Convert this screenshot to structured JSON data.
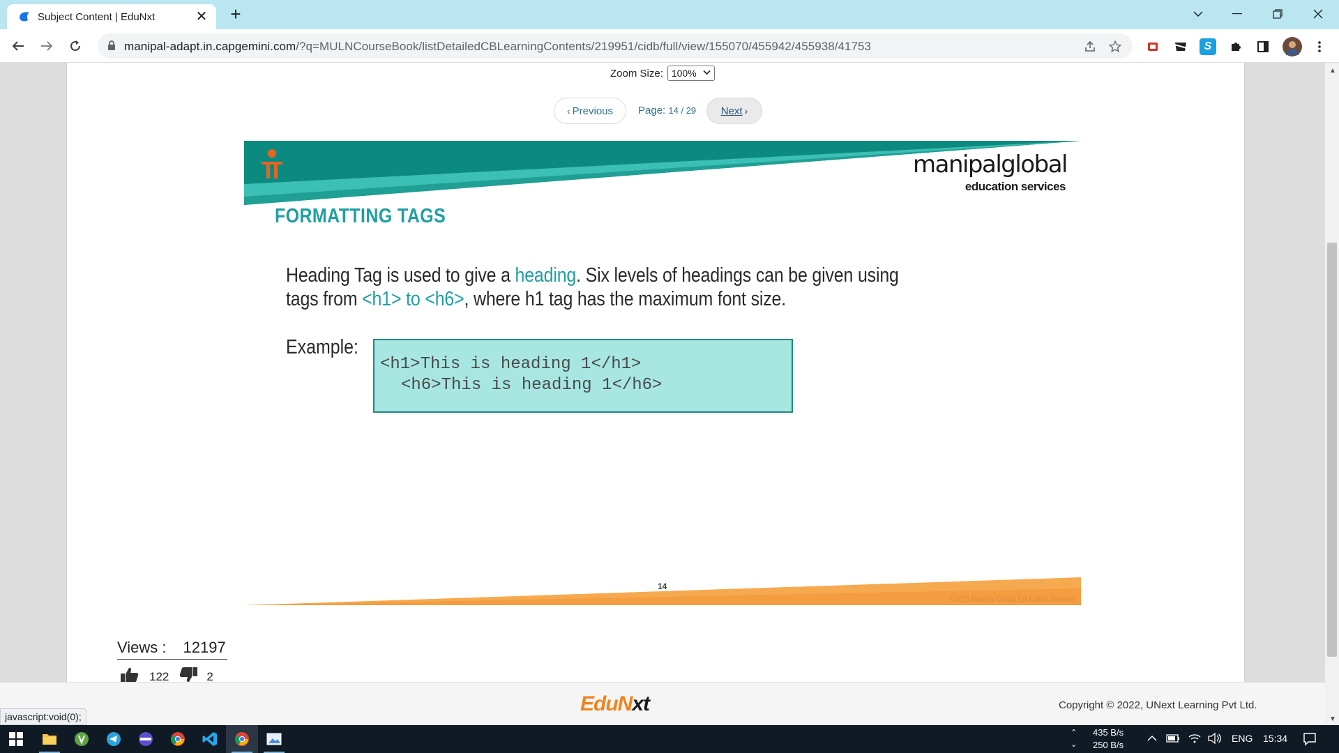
{
  "browser": {
    "tab_title": "Subject Content | EduNxt",
    "url_host": "manipal-adapt.in.capgemini.com",
    "url_path": "/?q=MULNCourseBook/listDetailedCBLearningContents/219951/cidb/full/view/155070/455942/455938/41753"
  },
  "viewer": {
    "zoom_label": "Zoom Size:",
    "zoom_value": "100%",
    "prev_label": "Previous",
    "page_label": "Page:",
    "page_current": "14",
    "page_total": "29",
    "next_label": "Next"
  },
  "slide": {
    "brand_name": "manipalglobal",
    "brand_sub": "education services",
    "title": "FORMATTING TAGS",
    "body_1": "Heading Tag is used to give a ",
    "body_hl_1": "heading",
    "body_2": ". Six levels of headings can be given using tags from ",
    "body_hl_2": "<h1> to <h6>",
    "body_3": ", where h1 tag has the maximum font size.",
    "example_label": "Example:",
    "code_line_1": "<h1>This is heading 1</h1>",
    "code_line_2": "<h6>This is heading 1</h6>",
    "slide_number": "14",
    "slide_copyright": "©2015 Manipal Global Education Services",
    "colors": {
      "teal_dark": "#0d8a80",
      "teal_light": "#3cbfb5",
      "title": "#1f9fa2",
      "code_bg": "#a8e6e1",
      "footer_orange": "#f6a94e"
    }
  },
  "stats": {
    "views_label": "Views :",
    "views_value": "12197",
    "likes": "122",
    "dislikes": "2"
  },
  "footer": {
    "logo_a": "EduN",
    "logo_b": "x",
    "logo_c": "t",
    "copyright": "Copyright © 2022, UNext Learning Pvt Ltd."
  },
  "status_bar": {
    "url": "javascript:void(0);"
  },
  "taskbar": {
    "net_up": "435 B/s",
    "net_down": "250 B/s",
    "lang": "ENG",
    "time": "15:34"
  },
  "icons": {
    "tab": "edunxt-favicon-icon",
    "nav": [
      "back-arrow-icon",
      "forward-arrow-icon",
      "reload-icon",
      "lock-icon"
    ],
    "omnibox": [
      "share-icon",
      "star-icon"
    ],
    "extensions": [
      "pdf-extension-icon",
      "ninja-extension-icon",
      "s-extension-icon",
      "puzzle-icon",
      "sidepanel-icon",
      "profile-avatar"
    ],
    "taskbar": [
      "windows-start-icon",
      "file-explorer-icon",
      "app-green-icon",
      "telegram-icon",
      "app-purple-icon",
      "chrome-icon",
      "vscode-icon",
      "chrome-active-icon",
      "photos-icon"
    ]
  }
}
